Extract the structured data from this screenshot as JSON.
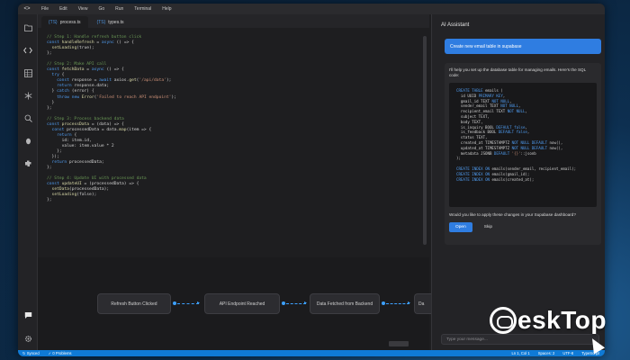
{
  "menubar": {
    "logo": "<>",
    "items": [
      "File",
      "Edit",
      "View",
      "Go",
      "Run",
      "Terminal",
      "Help"
    ]
  },
  "activity_icons": [
    "folder-icon",
    "code-icon",
    "table-icon",
    "git-branch-icon",
    "search-icon",
    "bug-icon",
    "extensions-icon",
    "chat-icon",
    "settings-icon"
  ],
  "tabs": [
    {
      "ext": "{TS}",
      "label": "process.ts"
    },
    {
      "ext": "{TS}",
      "label": "types.ts"
    }
  ],
  "code_lines": [
    "// Step 1: Handle refresh button click",
    "const handleRefresh = async () => {",
    "  setLoading(true);",
    "};",
    "",
    "// Step 2: Make API call",
    "const fetchData = async () => {",
    "  try {",
    "    const response = await axios.get('/api/data');",
    "    return response.data;",
    "  } catch (error) {",
    "    throw new Error('Failed to reach API endpoint');",
    "  }",
    "};",
    "",
    "// Step 3: Process backend data",
    "const processData = (data) => {",
    "  const processedData = data.map(item => {",
    "    return {",
    "      id: item.id,",
    "      value: item.value * 2",
    "    };",
    "  });",
    "  return processedData;",
    "};",
    "",
    "// Step 4: Update UI with processed data",
    "const updateUI = (processedData) => {",
    "  setData(processedData);",
    "  setLoading(false);",
    "};"
  ],
  "flow": {
    "nodes": [
      "Refresh Button Clicked",
      "API Endpoint Reached",
      "Data Fetched from Backend",
      "Da"
    ]
  },
  "ai": {
    "title": "AI Assistant",
    "user_message": "Create new email table in supabase",
    "intro": "I'll help you set up the database table for managing emails. Here's the SQL code:",
    "sql_lines": [
      "CREATE TABLE emails (",
      "  id UUID PRIMARY KEY,",
      "  gmail_id TEXT NOT NULL,",
      "  sender_email TEXT NOT NULL,",
      "  recipient_email TEXT NOT NULL,",
      "  subject TEXT,",
      "  body TEXT,",
      "  is_inquiry BOOL DEFAULT false,",
      "  is_feedback BOOL DEFAULT false,",
      "  status TEXT,",
      "  created_at TIMESTAMPTZ NOT NULL DEFAULT now(),",
      "  updated_at TIMESTAMPTZ NOT NULL DEFAULT now(),",
      "  metadata JSONB DEFAULT '{}'::jsonb",
      ");",
      "",
      "CREATE INDEX ON emails(sender_email, recipient_email);",
      "CREATE INDEX ON emails(gmail_id);",
      "CREATE INDEX ON emails(created_at);"
    ],
    "question": "Would you like to apply these changes in your Supabase dashboard?",
    "open_label": "Open",
    "skip_label": "Skip",
    "input_placeholder": "Type your message..."
  },
  "status": {
    "sync": "Synced",
    "problems": "0 Problems",
    "position": "Ln 1, Col 1",
    "spaces": "Spaces: 2",
    "encoding": "UTF-8",
    "language": "TypeScript"
  },
  "brand": {
    "text": "eskTop"
  },
  "colors": {
    "accent": "#2f7de1",
    "status_bar": "#0f7ad6",
    "flow_connector": "#3da0ff"
  }
}
